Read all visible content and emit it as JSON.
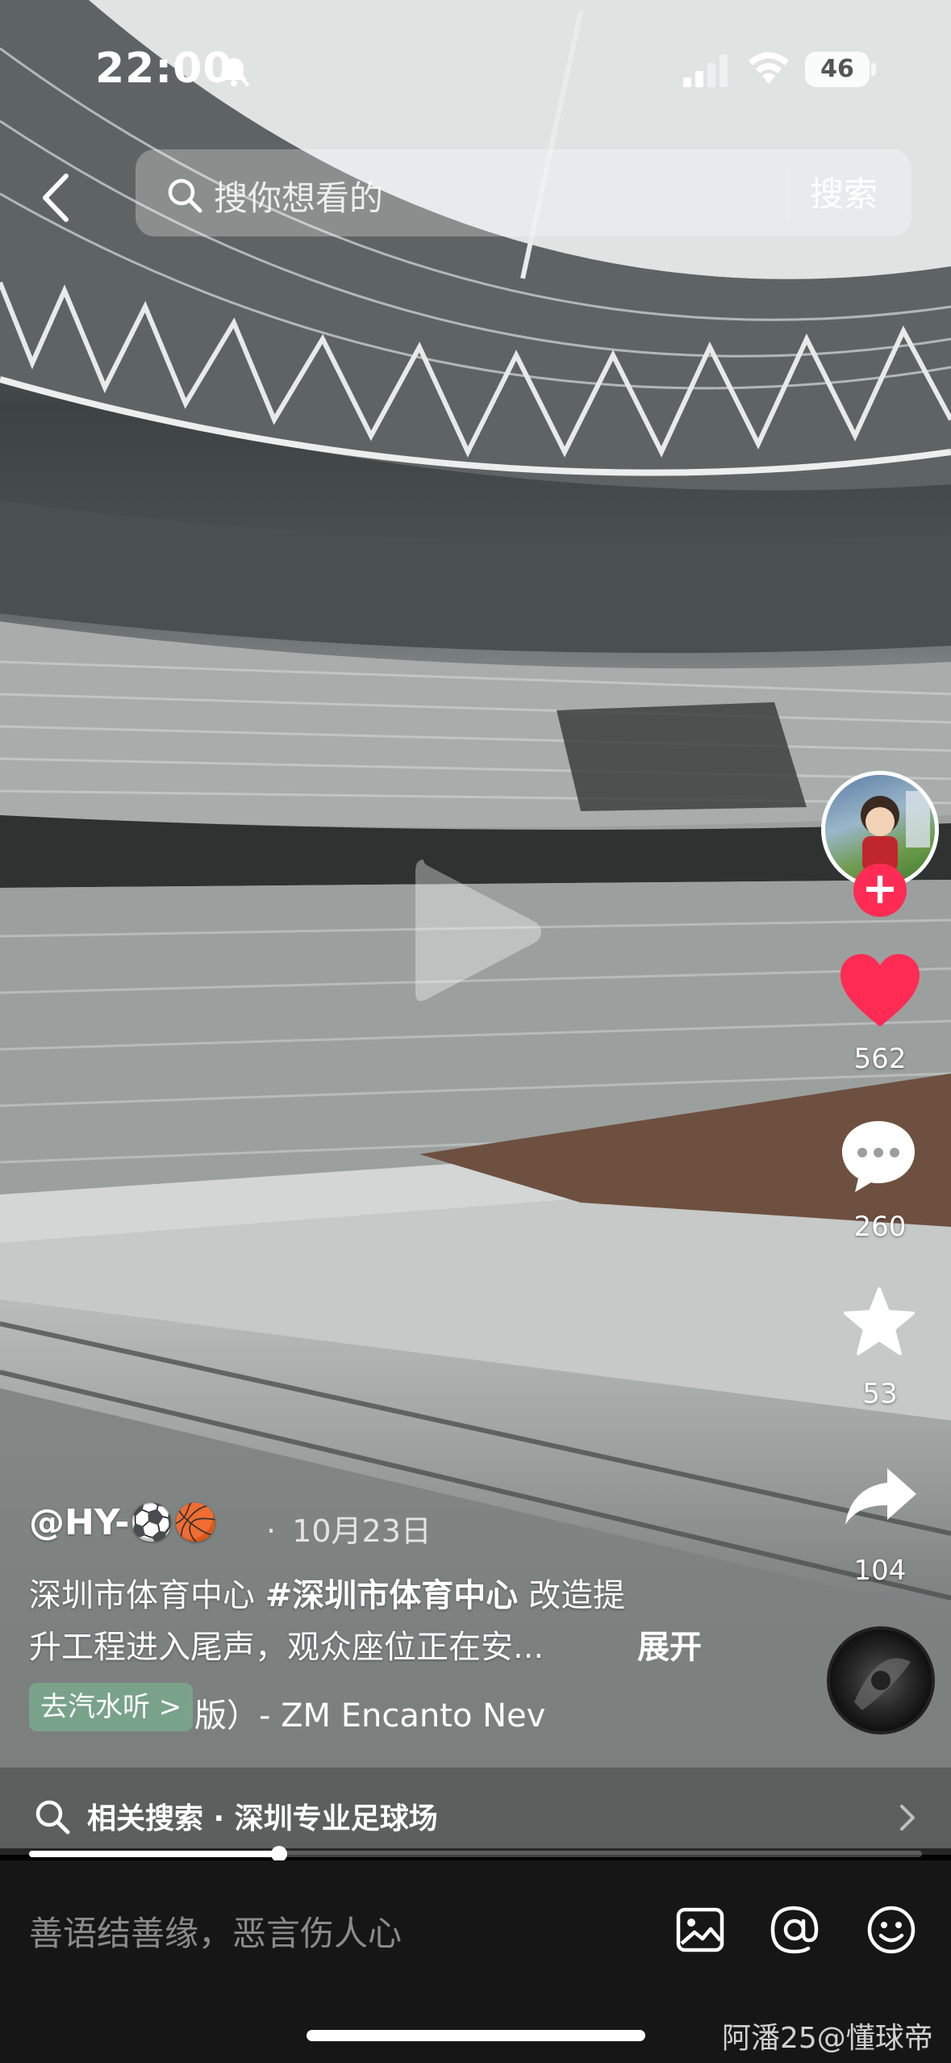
{
  "status_bar": {
    "time": "22:00",
    "battery": "46"
  },
  "search": {
    "placeholder": "搜你想看的",
    "button_label": "搜索"
  },
  "rail": {
    "likes": "562",
    "comments": "260",
    "favorites": "53",
    "shares": "104"
  },
  "post": {
    "author": "@HY-⚽🏀",
    "date_sep": "·",
    "date": "10月23日",
    "caption_line1_pre": "深圳市体育中心 ",
    "caption_hashtag": "#深圳市体育中心",
    "caption_line1_post": " 改造提",
    "caption_line2": "升工程进入尾声，观众座位正在安...",
    "expand_label": "展开",
    "music_chip": "去汽水听 >",
    "music_title": "版）- ZM    Encanto Nev"
  },
  "related": {
    "label": "相关搜索 · 深圳专业足球场"
  },
  "progress": {
    "fraction": 0.28
  },
  "comment_bar": {
    "placeholder": "善语结善缘，恶言伤人心"
  },
  "watermark": "阿潘25@懂球帝",
  "icons": [
    "bell-off-icon",
    "signal-icon",
    "wifi-icon",
    "back-icon",
    "search-icon",
    "play-icon",
    "plus-icon",
    "heart-icon",
    "comment-icon",
    "star-icon",
    "share-icon",
    "music-disc-icon",
    "chevron-right-icon",
    "image-icon",
    "at-icon",
    "emoji-icon"
  ],
  "colors": {
    "accent": "#fe2c55",
    "comment_bar_bg": "#161616"
  }
}
